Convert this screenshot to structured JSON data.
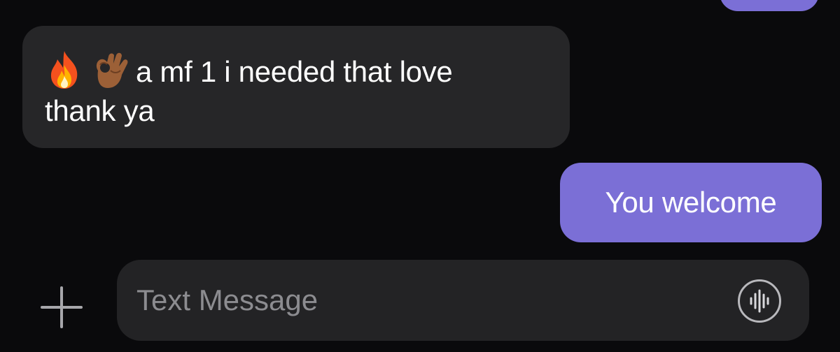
{
  "conversation": {
    "incoming_message": {
      "emojis": [
        "fire-emoji",
        "ok-hand-emoji"
      ],
      "line1": "a mf 1 i needed that love",
      "line2": "thank ya"
    },
    "outgoing_message": {
      "text": "You welcome"
    }
  },
  "composer": {
    "add_icon": "plus-icon",
    "placeholder": "Text Message",
    "voice_icon": "waveform-icon"
  },
  "colors": {
    "background": "#0a0a0c",
    "incoming_bubble": "#262628",
    "outgoing_bubble": "#7b6fd6",
    "input_field": "#232325",
    "placeholder_text": "#8c8c90"
  }
}
